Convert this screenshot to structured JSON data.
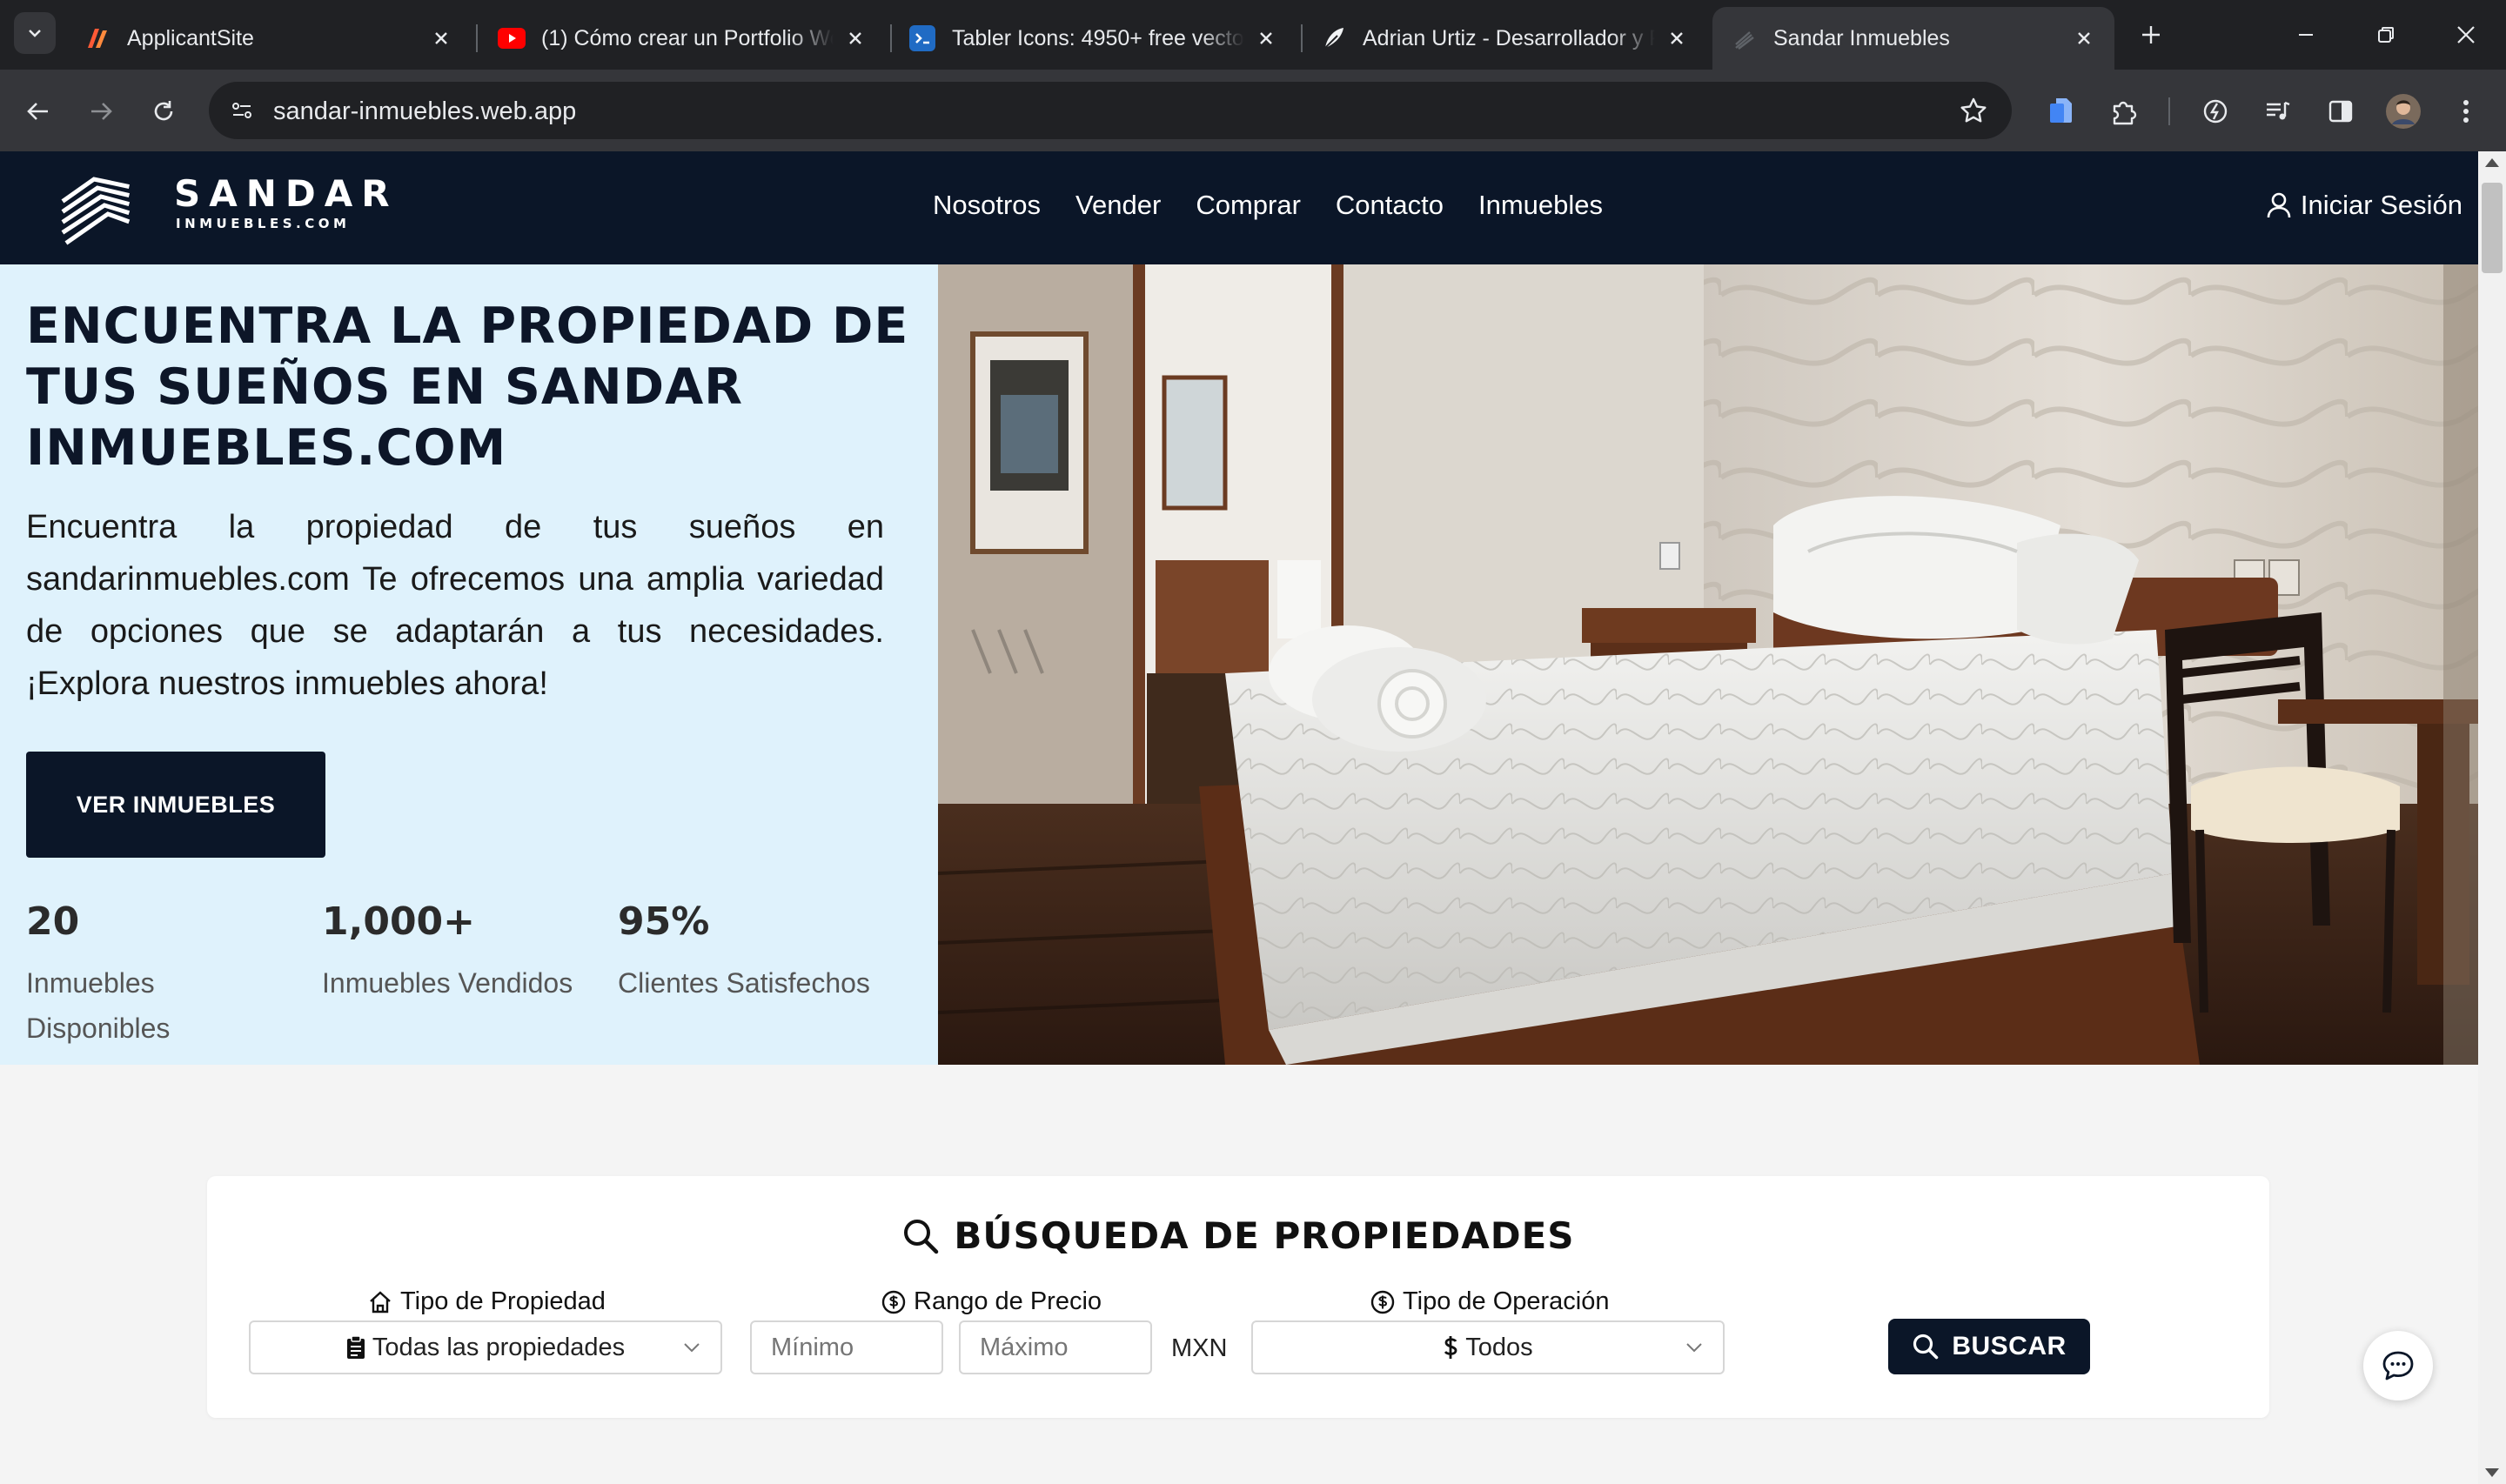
{
  "browser": {
    "tabs": [
      {
        "title": "ApplicantSite",
        "favicon": "applicantsite-icon"
      },
      {
        "title": "(1) Cómo crear un Portfolio Web",
        "favicon": "youtube-icon"
      },
      {
        "title": "Tabler Icons: 4950+ free vector icons",
        "favicon": "tabler-icon"
      },
      {
        "title": "Adrian Urtiz - Desarrollador y Programador",
        "favicon": "feather-icon"
      },
      {
        "title": "Sandar Inmuebles",
        "favicon": "sandar-icon",
        "active": true
      }
    ],
    "url": "sandar-inmuebles.web.app"
  },
  "site": {
    "brand": {
      "name": "SANDAR",
      "sub": "INMUEBLES.COM"
    },
    "nav": [
      "Nosotros",
      "Vender",
      "Comprar",
      "Contacto",
      "Inmuebles"
    ],
    "login_label": "Iniciar Sesión",
    "colors": {
      "navy": "#0b1628",
      "hero_bg": "#dff2fc"
    }
  },
  "hero": {
    "title": "ENCUENTRA LA PROPIEDAD DE TUS SUEÑOS EN SANDAR INMUEBLES.COM",
    "description": "Encuentra la propiedad de tus sueños en sandarinmuebles.com Te ofrecemos una amplia variedad de opciones que se adaptarán a tus necesidades. ¡Explora nuestros inmuebles ahora!",
    "cta": "VER INMUEBLES",
    "stats": [
      {
        "value": "20",
        "label": "Inmuebles Disponibles"
      },
      {
        "value": "1,000+",
        "label": "Inmuebles Vendidos"
      },
      {
        "value": "95%",
        "label": "Clientes Satisfechos"
      }
    ]
  },
  "search": {
    "title": "BÚSQUEDA DE PROPIEDADES",
    "property_type": {
      "label": "Tipo de Propiedad",
      "value": "Todas las propiedades"
    },
    "price": {
      "label": "Rango de Precio",
      "min_placeholder": "Mínimo",
      "max_placeholder": "Máximo",
      "currency": "MXN"
    },
    "operation": {
      "label": "Tipo de Operación",
      "value": "Todos"
    },
    "button": "BUSCAR"
  }
}
